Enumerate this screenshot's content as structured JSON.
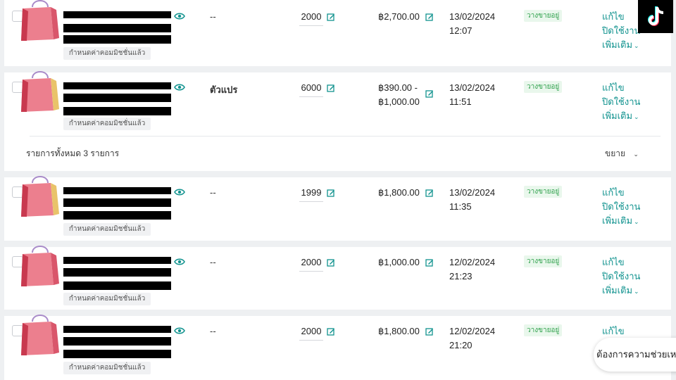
{
  "commission_tag": "กำหนดค่าคอมมิชชั่นแล้ว",
  "products": [
    {
      "variant": "--",
      "stock": "2000",
      "price_line1": "฿2,700.00",
      "price_line2": "",
      "date": "13/02/2024",
      "time": "12:07",
      "status": "วางขายอยู่"
    },
    {
      "variant": "ตัวแปร",
      "stock": "6000",
      "price_line1": "฿390.00 -",
      "price_line2": "฿1,000.00",
      "date": "13/02/2024",
      "time": "11:51",
      "status": "วางขายอยู่"
    },
    {
      "variant": "--",
      "stock": "1999",
      "price_line1": "฿1,800.00",
      "price_line2": "",
      "date": "13/02/2024",
      "time": "11:35",
      "status": "วางขายอยู่"
    },
    {
      "variant": "--",
      "stock": "2000",
      "price_line1": "฿1,000.00",
      "price_line2": "",
      "date": "12/02/2024",
      "time": "21:23",
      "status": "วางขายอยู่"
    },
    {
      "variant": "--",
      "stock": "2000",
      "price_line1": "฿1,800.00",
      "price_line2": "",
      "date": "12/02/2024",
      "time": "21:20",
      "status": "วางขายอยู่"
    }
  ],
  "actions": {
    "edit": "แก้ไข",
    "deactivate": "ปิดใช้งาน",
    "more": "เพิ่มเติม"
  },
  "group_summary": "รายการทั้งหมด 3 รายการ",
  "expand_label": "ขยาย",
  "help_text": "ต้องการความช่วยเหลือ",
  "colors": {
    "accent": "#12938f",
    "status_bg": "#e9f7ec",
    "status_text": "#2ea04b",
    "bag_pink": "#ec7f8e",
    "bag_dark": "#c8394f"
  },
  "icons": [
    "eye-icon",
    "pencil-edit-icon",
    "chevron-down-icon",
    "tiktok-logo-icon",
    "shopping-bag-icon"
  ]
}
